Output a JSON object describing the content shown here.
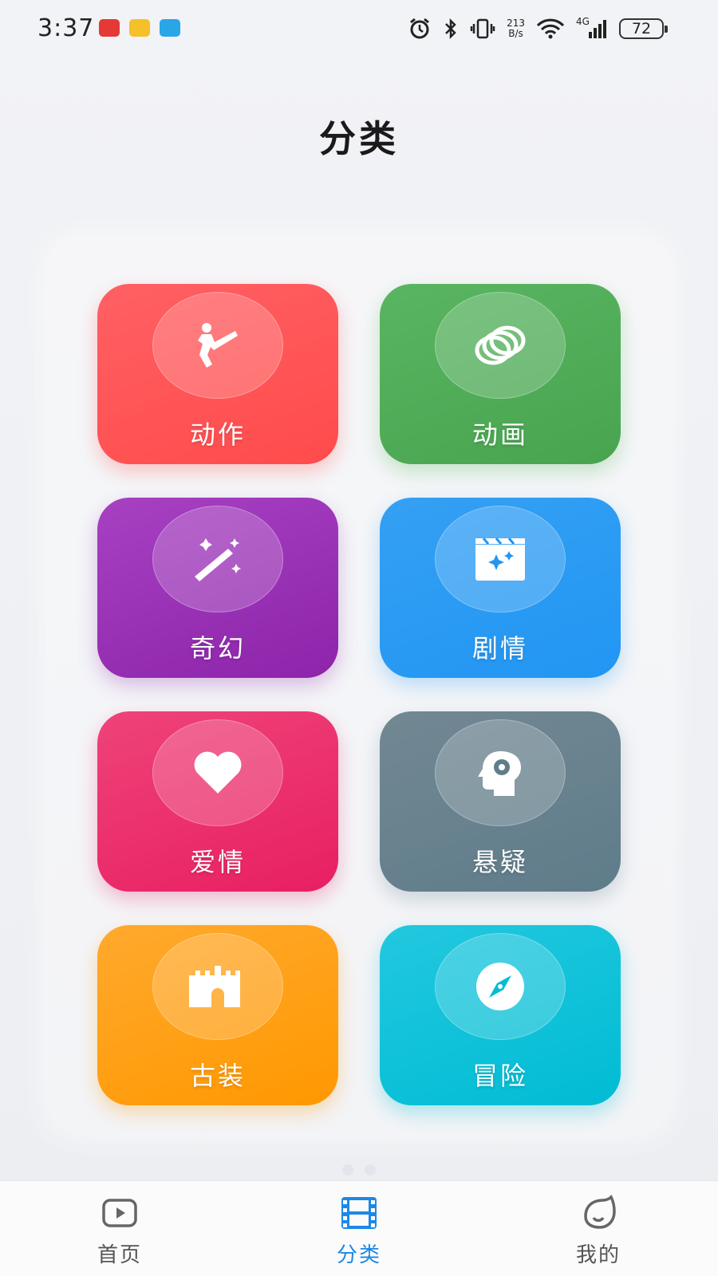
{
  "status_bar": {
    "time": "3:37",
    "net_speed_value": "213",
    "net_speed_unit": "B/s",
    "network_type": "4G",
    "battery": "72",
    "icons": [
      "huawei-app-icon",
      "email-icon",
      "message-icon",
      "alarm-icon",
      "bluetooth-icon",
      "vibrate-icon",
      "wifi-icon",
      "signal-icon",
      "battery-icon"
    ]
  },
  "page": {
    "title": "分类"
  },
  "categories": [
    {
      "label": "动作",
      "icon": "martial-arts-kick-icon",
      "color_from": "#ff5a5f",
      "color_to": "#ff4a4a"
    },
    {
      "label": "动画",
      "icon": "rings-icon",
      "color_from": "#55b05c",
      "color_to": "#49a54f"
    },
    {
      "label": "奇幻",
      "icon": "magic-wand-icon",
      "color_from": "#a03dbd",
      "color_to": "#8e24aa"
    },
    {
      "label": "剧情",
      "icon": "clapperboard-icon",
      "color_from": "#2f9cf2",
      "color_to": "#2196f3"
    },
    {
      "label": "爱情",
      "icon": "heart-icon",
      "color_from": "#ec3f78",
      "color_to": "#e91e63"
    },
    {
      "label": "悬疑",
      "icon": "brain-gear-icon",
      "color_from": "#6f8591",
      "color_to": "#607d8b"
    },
    {
      "label": "古装",
      "icon": "castle-icon",
      "color_from": "#ffa525",
      "color_to": "#ff9800"
    },
    {
      "label": "冒险",
      "icon": "compass-icon",
      "color_from": "#1cc6de",
      "color_to": "#00bcd4"
    }
  ],
  "bottom_nav": {
    "active_color": "#1e88e5",
    "items": [
      {
        "label": "首页",
        "icon": "play-screen-icon",
        "active": false
      },
      {
        "label": "分类",
        "icon": "film-strip-icon",
        "active": true
      },
      {
        "label": "我的",
        "icon": "face-icon",
        "active": false
      }
    ]
  }
}
